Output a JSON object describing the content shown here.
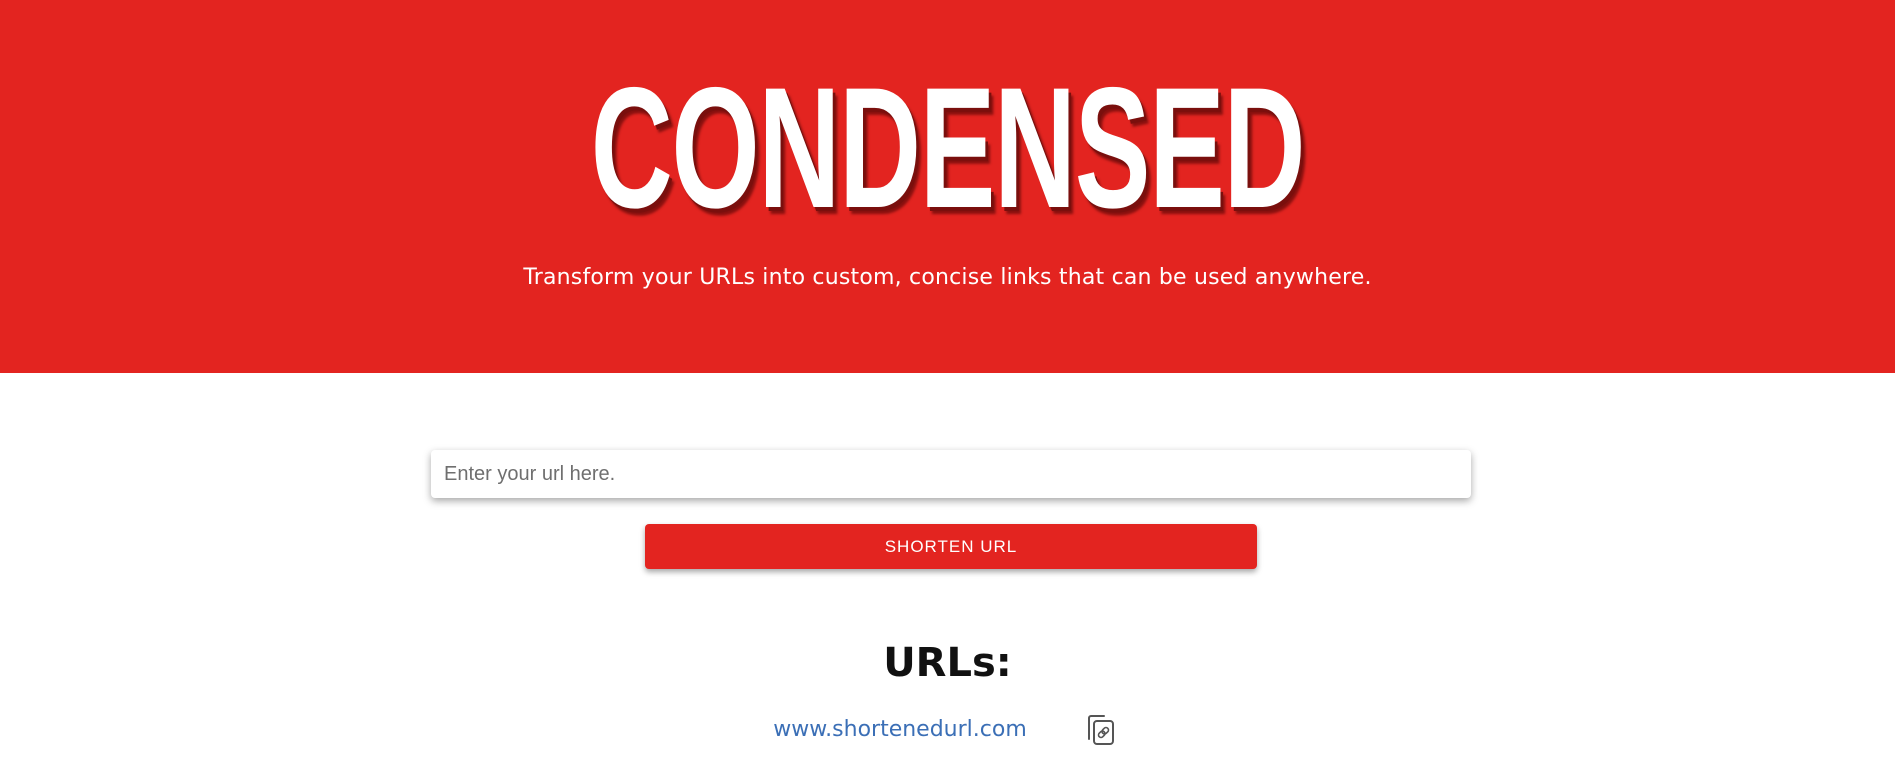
{
  "hero": {
    "title": "CONDENSED",
    "subtitle": "Transform your URLs into custom, concise links that can be used anywhere.",
    "background_color": "#e32420"
  },
  "form": {
    "input_placeholder": "Enter your url here.",
    "input_value": "",
    "shorten_label": "SHORTEN URL"
  },
  "results": {
    "heading": "URLs:",
    "items": [
      {
        "url": "www.shortenedurl.com",
        "action_icon": "copy-link-icon"
      }
    ]
  },
  "colors": {
    "accent": "#e32420",
    "link": "#3b6fb6"
  }
}
